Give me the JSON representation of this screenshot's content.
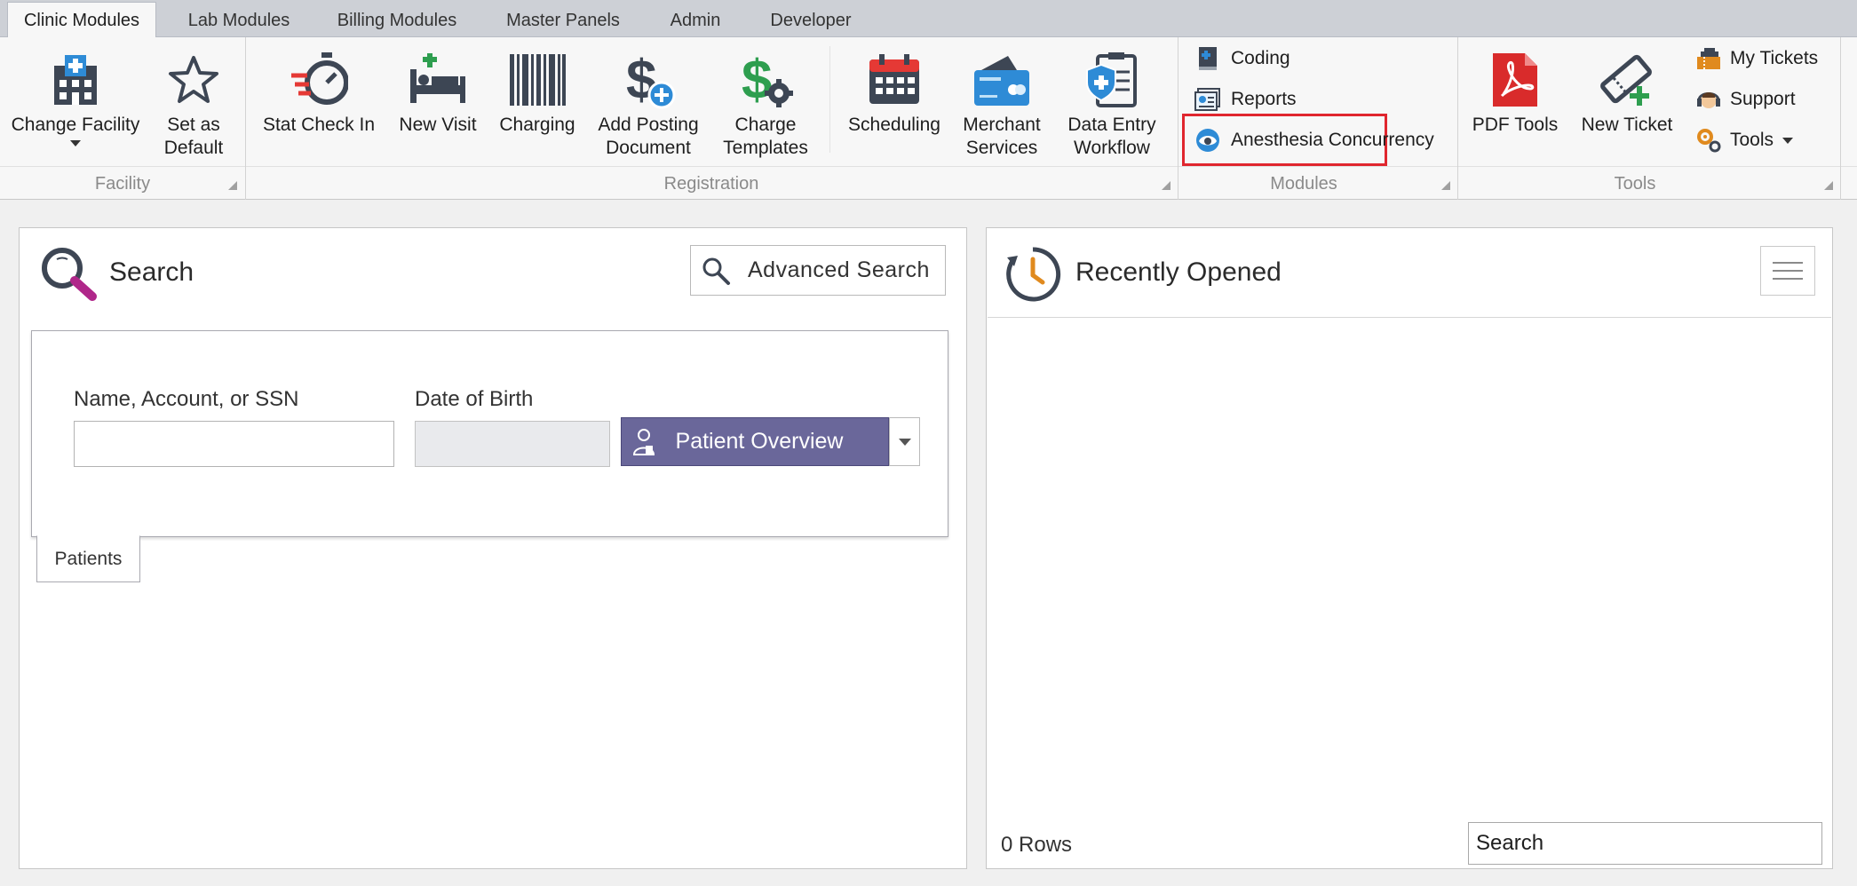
{
  "tabs": [
    "Clinic Modules",
    "Lab Modules",
    "Billing Modules",
    "Master Panels",
    "Admin",
    "Developer"
  ],
  "active_tab": "Clinic Modules",
  "ribbon": {
    "facility": {
      "label": "Facility",
      "change_facility": "Change Facility",
      "set_as_default": "Set as\nDefault"
    },
    "registration": {
      "label": "Registration",
      "stat_check_in": "Stat Check In",
      "new_visit": "New Visit",
      "charging": "Charging",
      "add_posting_document": "Add Posting\nDocument",
      "charge_templates": "Charge\nTemplates",
      "scheduling": "Scheduling",
      "merchant_services": "Merchant\nServices",
      "data_entry_workflow": "Data Entry\nWorkflow"
    },
    "modules": {
      "label": "Modules",
      "coding": "Coding",
      "reports": "Reports",
      "anesthesia_concurrency": "Anesthesia Concurrency"
    },
    "tools": {
      "label": "Tools",
      "pdf_tools": "PDF Tools",
      "new_ticket": "New Ticket",
      "my_tickets": "My Tickets",
      "support": "Support",
      "tools_menu": "Tools"
    }
  },
  "search_panel": {
    "title": "Search",
    "advanced_search": "Advanced Search",
    "name_label": "Name, Account, or SSN",
    "name_value": "",
    "dob_label": "Date of Birth",
    "dob_value": "",
    "patient_overview": "Patient Overview",
    "tab_patients": "Patients"
  },
  "recent_panel": {
    "title": "Recently Opened",
    "rows_count": "0 Rows",
    "search_placeholder": "Search"
  },
  "colors": {
    "highlight": "#e0262e",
    "primary_button": "#6a679a",
    "tab_strip": "#cdd0d6",
    "ribbon_bg": "#f7f7f7"
  }
}
